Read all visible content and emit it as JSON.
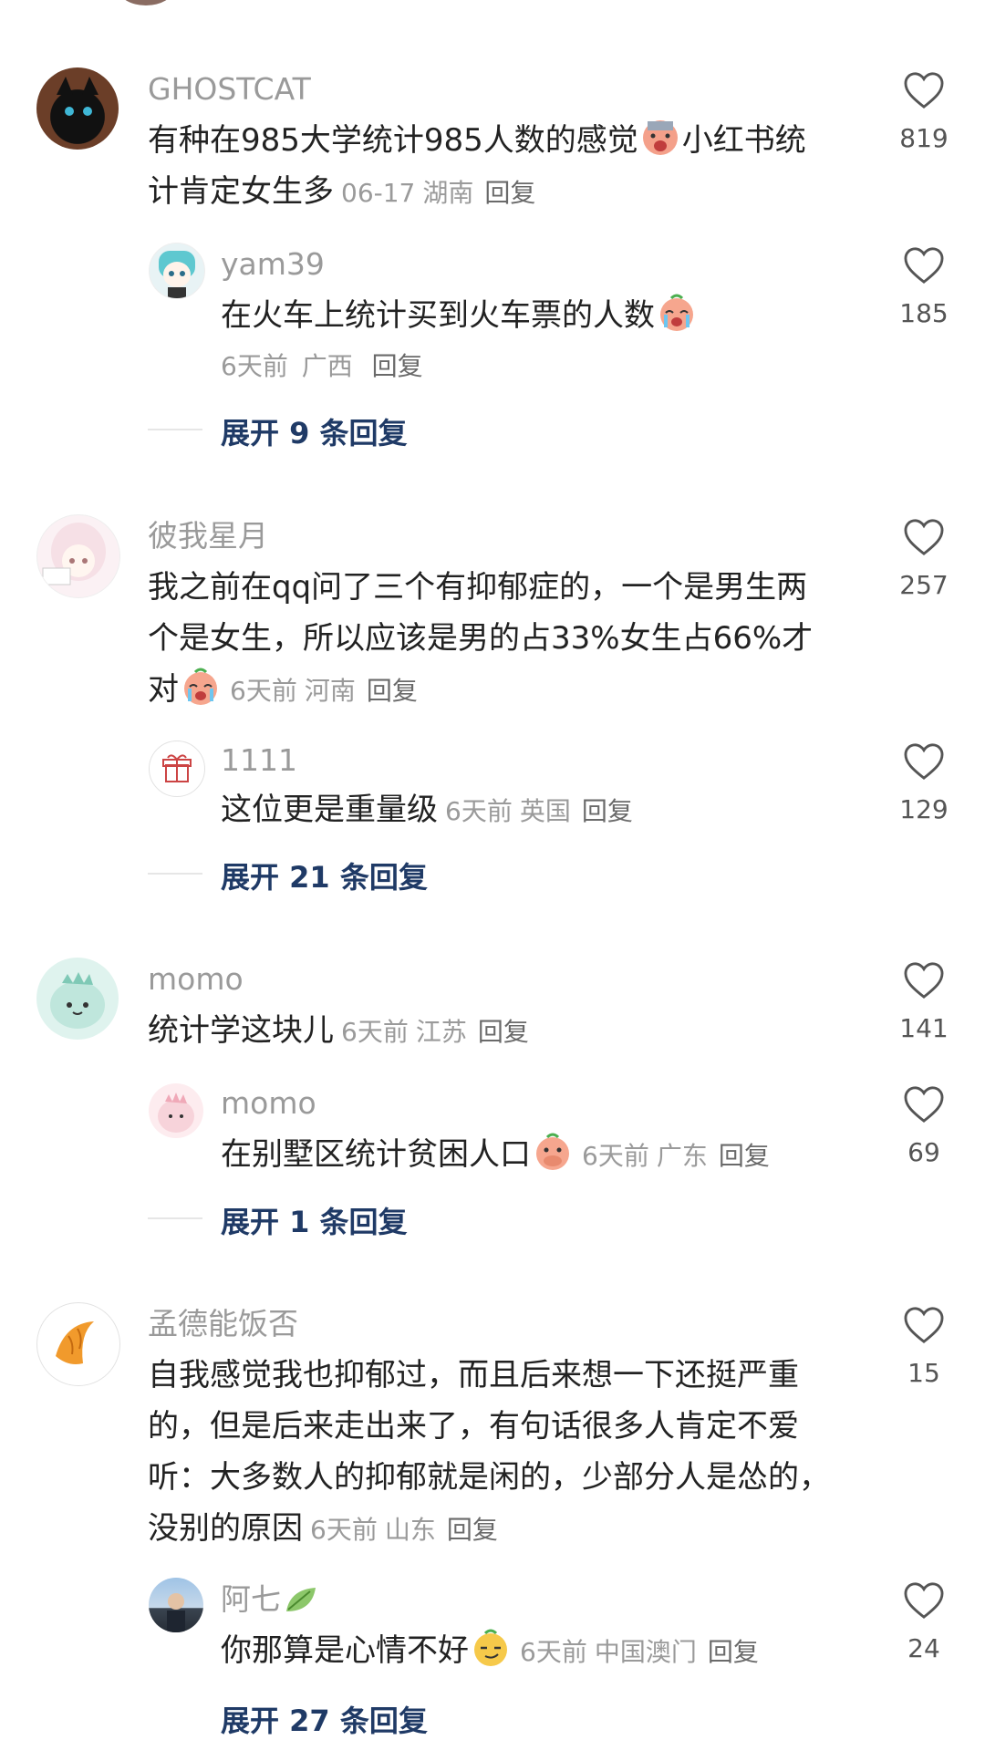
{
  "comments": [
    {
      "username": "GHOSTCAT",
      "text_line1": "有种在985大学统计985人数的感觉",
      "text_line1b": "小红书统",
      "text_line2": "计肯定女生多",
      "date": "06-17",
      "location": "湖南",
      "reply_label": "回复",
      "likes": "819",
      "replies": [
        {
          "username": "yam39",
          "text": "在火车上统计买到火车票的人数",
          "date": "6天前",
          "location": "广西",
          "reply_label": "回复",
          "likes": "185"
        }
      ],
      "expand_label": "展开 9 条回复"
    },
    {
      "username": "彼我星月",
      "text_line1": "我之前在qq问了三个有抑郁症的，一个是男生两",
      "text_line2": "个是女生，所以应该是男的占33%女生占66%才",
      "text_line3": "对",
      "date": "6天前",
      "location": "河南",
      "reply_label": "回复",
      "likes": "257",
      "replies": [
        {
          "username": "1111",
          "text": "这位更是重量级",
          "date": "6天前",
          "location": "英国",
          "reply_label": "回复",
          "likes": "129"
        }
      ],
      "expand_label": "展开 21 条回复"
    },
    {
      "username": "momo",
      "text": "统计学这块儿",
      "date": "6天前",
      "location": "江苏",
      "reply_label": "回复",
      "likes": "141",
      "replies": [
        {
          "username": "momo",
          "text": "在别墅区统计贫困人口",
          "date": "6天前",
          "location": "广东",
          "reply_label": "回复",
          "likes": "69"
        }
      ],
      "expand_label": "展开 1 条回复"
    },
    {
      "username": "孟德能饭否",
      "text_line1": "自我感觉我也抑郁过，而且后来想一下还挺严重",
      "text_line2": "的，但是后来走出来了，有句话很多人肯定不爱",
      "text_line3": "听：大多数人的抑郁就是闲的，少部分人是怂的，",
      "text_line4": "没别的原因",
      "date": "6天前",
      "location": "山东",
      "reply_label": "回复",
      "likes": "15",
      "replies": [
        {
          "username": "阿七",
          "text": "你那算是心情不好",
          "date": "6天前",
          "location": "中国澳门",
          "reply_label": "回复",
          "likes": "24"
        }
      ],
      "expand_label": "展开 27 条回复"
    }
  ],
  "icons": {
    "like": "heart-outline-icon",
    "emoji_cry": "crying-face-emoji",
    "emoji_shy": "covering-mouth-emoji",
    "emoji_smirk": "smirk-face-emoji",
    "leaf": "leaf-icon"
  },
  "colors": {
    "username": "#9a9a9a",
    "text": "#222222",
    "meta": "#9a9a9a",
    "expand": "#1f3a66"
  }
}
